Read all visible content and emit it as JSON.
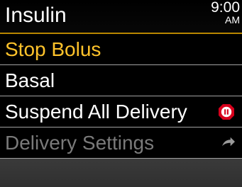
{
  "header": {
    "title": "Insulin",
    "time": "9:00",
    "ampm": "AM"
  },
  "menu": {
    "items": [
      {
        "label": "Stop Bolus",
        "state": "selected"
      },
      {
        "label": "Basal",
        "state": "normal"
      },
      {
        "label": "Suspend All Delivery",
        "state": "normal",
        "icon": "suspend-stop-icon"
      },
      {
        "label": "Delivery Settings",
        "state": "disabled",
        "icon": "forward-arrow-icon"
      }
    ]
  },
  "colors": {
    "accent": "#ffc32b",
    "suspend_icon": "#d6001c",
    "disabled_text": "#7a7a7a"
  }
}
